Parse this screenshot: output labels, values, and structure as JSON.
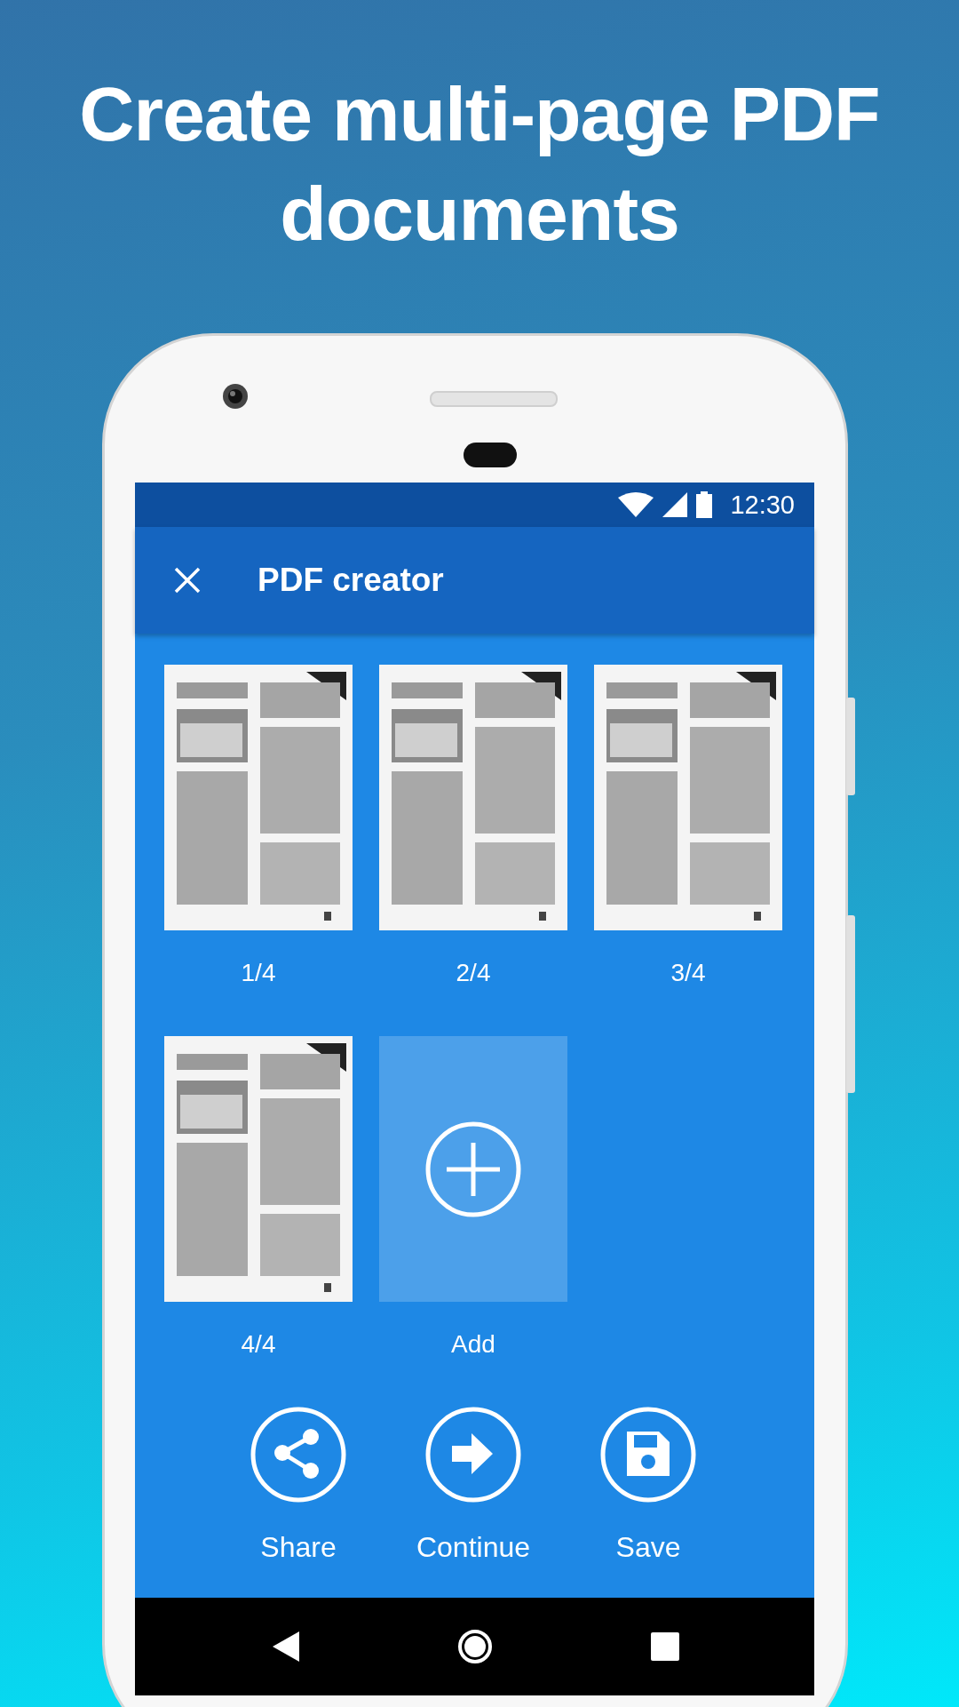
{
  "headline": "Create multi-page PDF documents",
  "status_bar": {
    "time": "12:30"
  },
  "app_bar": {
    "title": "PDF creator"
  },
  "pages": [
    {
      "label": "1/4",
      "kind": "picture"
    },
    {
      "label": "2/4",
      "kind": "picture"
    },
    {
      "label": "3/4",
      "kind": "picture"
    },
    {
      "label": "4/4",
      "kind": "picture"
    }
  ],
  "add_tile": {
    "label": "Add"
  },
  "actions": [
    {
      "label": "Share",
      "kind": "share"
    },
    {
      "label": "Continue",
      "kind": "continue"
    },
    {
      "label": "Save",
      "kind": "save"
    }
  ]
}
